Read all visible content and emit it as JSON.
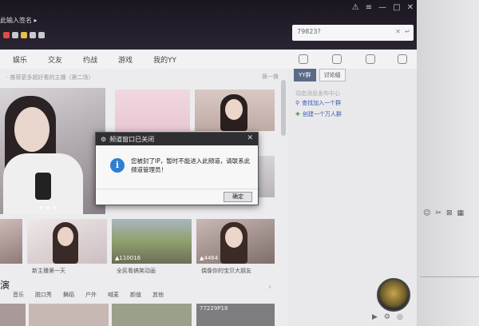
{
  "titlebar": {
    "user_prompt": "此输入签名 ▸",
    "window_controls": [
      "⚠",
      "≡",
      "—",
      "□",
      "✕"
    ]
  },
  "search": {
    "value": "79823?",
    "clear": "✕",
    "go": "↵"
  },
  "nav": {
    "items": [
      "娱乐",
      "交友",
      "约战",
      "游戏",
      "我的YY"
    ]
  },
  "main": {
    "subline": "· 推荐更多超好看的主播（第二场）",
    "refresh": "换一换",
    "cards": [
      {
        "label": "新主播第一天",
        "views": ""
      },
      {
        "label": "全民看搞笑动画",
        "views": "▲110016"
      },
      {
        "label": "偶像你的宝贝大朋友",
        "views": "▲4464"
      }
    ],
    "category_title": "演",
    "categories": [
      "音乐",
      "脱口秀",
      "舞蹈",
      "户外",
      "喊麦",
      "颜值",
      "其他"
    ],
    "row3_label": "77229P18",
    "next": "›"
  },
  "panel": {
    "tabs": [
      {
        "label": "YY群",
        "active": true
      },
      {
        "label": "讨论组",
        "active": false
      }
    ],
    "hint": "动态消息发布中心",
    "link_search": "查找加入一个群",
    "link_create": "创建一个万人群",
    "bottom_icons": [
      "▶",
      "⚙",
      "◎"
    ]
  },
  "desk_icons": [
    "☺",
    "✂",
    "⊠",
    "▦"
  ],
  "dialog": {
    "title": "频道窗口已关闭",
    "close": "✕",
    "info_icon": "i",
    "message": "您被封了IP，暂时不能进入此频道，请联系此频道管理员！",
    "ok": "确定"
  }
}
